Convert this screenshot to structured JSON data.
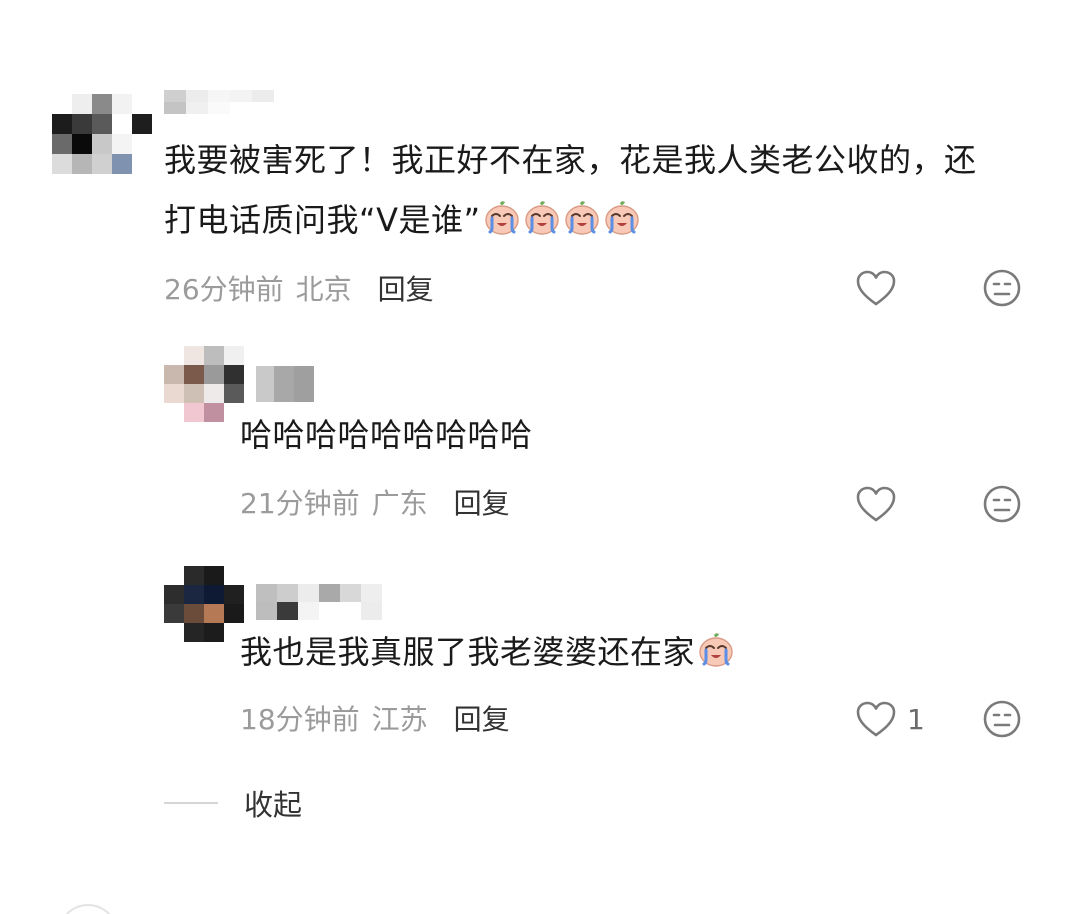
{
  "colors": {
    "meta_gray": "#9b9b9b",
    "text": "#1a1a1a",
    "icon_gray": "#7a7a7a",
    "emoji_fill": "#f7c9b6",
    "emoji_tear": "#5b8ee6"
  },
  "comment": {
    "avatar": "pixelated-avatar",
    "username": "",
    "text": "我要被害死了！我正好不在家，花是我人类老公收的，还打电话质问我“V是谁”",
    "emojis": [
      "crying-face-icon",
      "crying-face-icon",
      "crying-face-icon",
      "crying-face-icon"
    ],
    "time": "26分钟前",
    "location": "北京",
    "reply_label": "回复",
    "like_icon": "heart-outline-icon",
    "like_count": "",
    "dislike_icon": "neutral-face-icon"
  },
  "replies": [
    {
      "avatar": "pixelated-avatar",
      "username": "",
      "text": "哈哈哈哈哈哈哈哈哈",
      "emojis": [],
      "time": "21分钟前",
      "location": "广东",
      "reply_label": "回复",
      "like_icon": "heart-outline-icon",
      "like_count": "",
      "dislike_icon": "neutral-face-icon"
    },
    {
      "avatar": "pixelated-avatar",
      "username": "",
      "text": "我也是我真服了我老婆婆还在家",
      "emojis": [
        "crying-face-icon"
      ],
      "time": "18分钟前",
      "location": "江苏",
      "reply_label": "回复",
      "like_icon": "heart-outline-icon",
      "like_count": "1",
      "dislike_icon": "neutral-face-icon"
    }
  ],
  "collapse_label": "收起"
}
